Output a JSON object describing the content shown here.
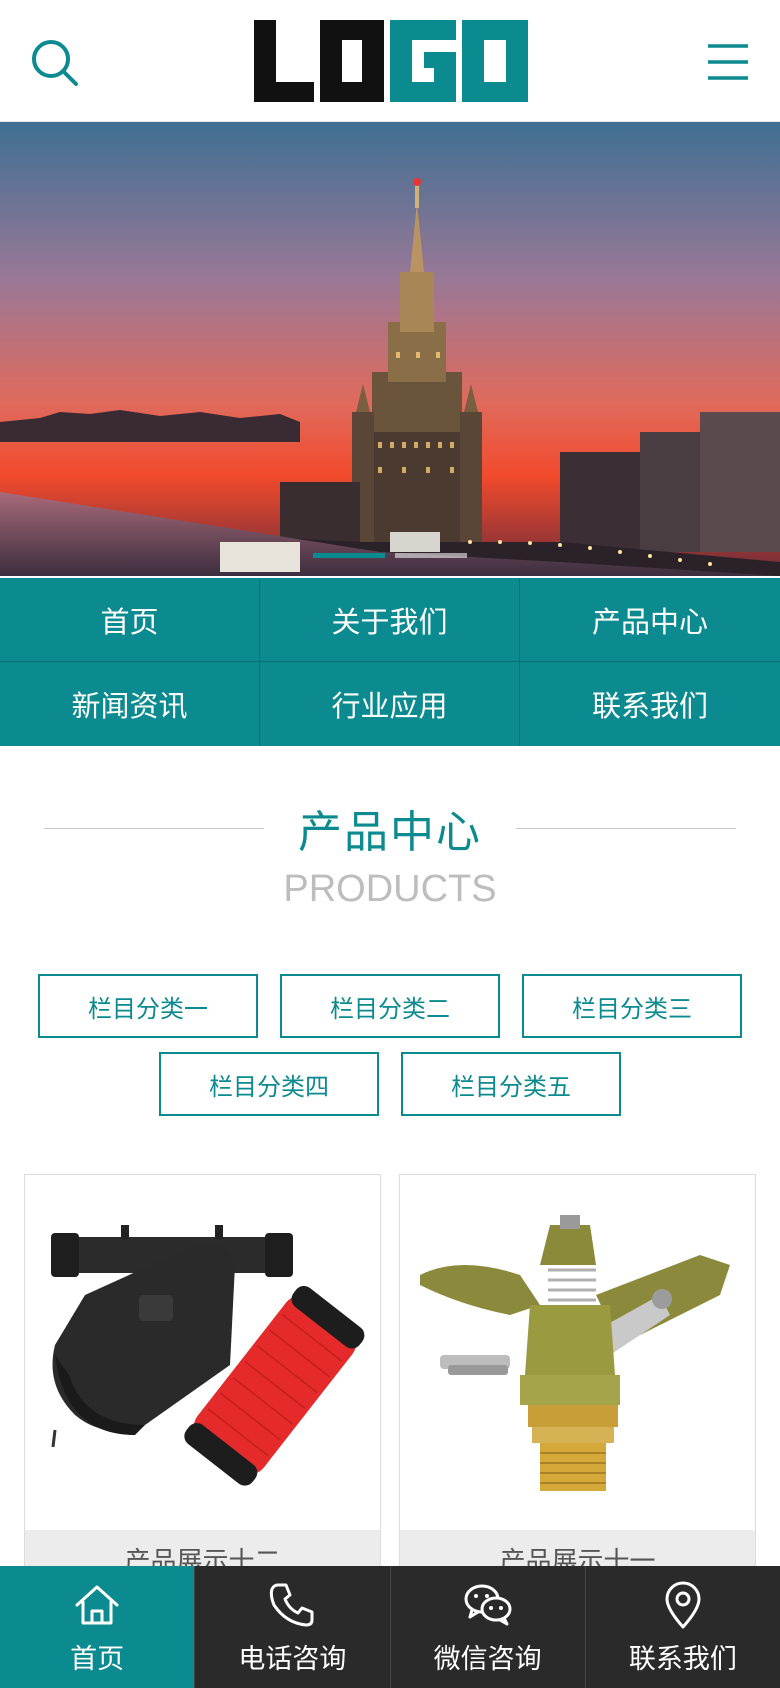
{
  "header": {
    "logo_text": "LOGO",
    "search_icon": "search-icon",
    "menu_icon": "hamburger-menu-icon"
  },
  "banner": {
    "slides": 2,
    "active_slide": 1
  },
  "nav": {
    "items": [
      {
        "label": "首页"
      },
      {
        "label": "关于我们"
      },
      {
        "label": "产品中心"
      },
      {
        "label": "新闻资讯"
      },
      {
        "label": "行业应用"
      },
      {
        "label": "联系我们"
      }
    ]
  },
  "section": {
    "title_cn": "产品中心",
    "title_en": "PRODUCTS"
  },
  "categories": [
    {
      "label": "栏目分类一"
    },
    {
      "label": "栏目分类二"
    },
    {
      "label": "栏目分类三"
    },
    {
      "label": "栏目分类四"
    },
    {
      "label": "栏目分类五"
    }
  ],
  "products": [
    {
      "name": "产品展示十二"
    },
    {
      "name": "产品展示十一"
    }
  ],
  "bottom_bar": {
    "tabs": [
      {
        "label": "首页",
        "icon": "home-icon"
      },
      {
        "label": "电话咨询",
        "icon": "phone-icon"
      },
      {
        "label": "微信咨询",
        "icon": "wechat-icon"
      },
      {
        "label": "联系我们",
        "icon": "location-pin-icon"
      }
    ]
  },
  "colors": {
    "accent": "#0b8a8f",
    "bottom_bar": "#2a2a2a",
    "logo_dark": "#111111"
  }
}
